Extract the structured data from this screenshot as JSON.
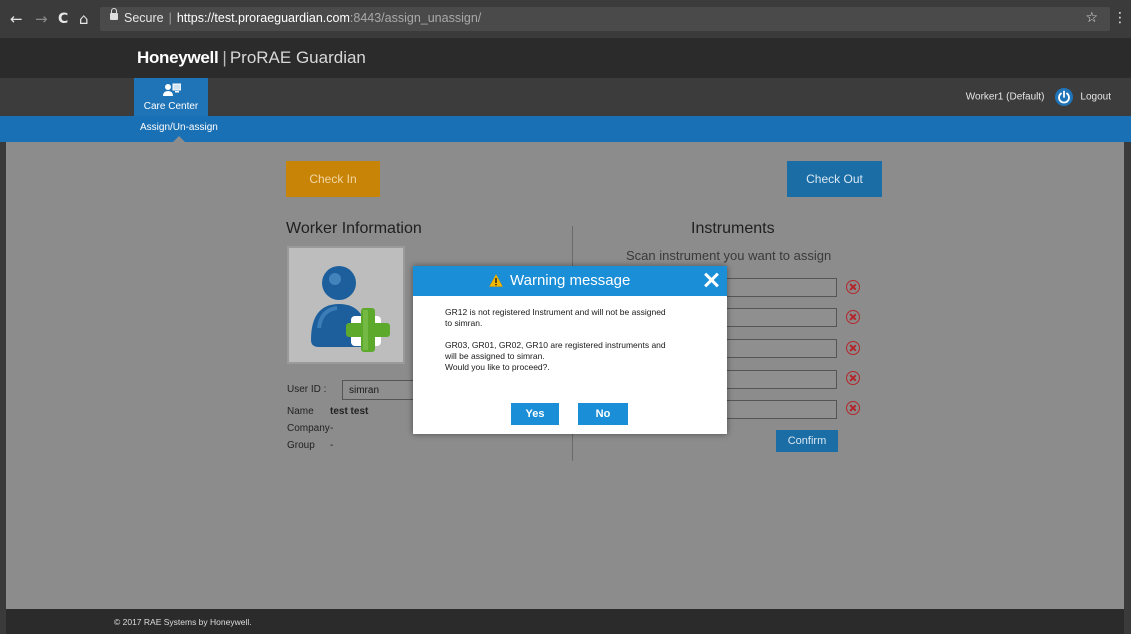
{
  "browser": {
    "back_icon": "←",
    "forward_icon": "→",
    "reload_icon": "C",
    "home_icon": "⌂",
    "secure_label": "Secure",
    "url_scheme": "https://",
    "url_host": "test.proraeguardian.com",
    "url_rest": ":8443/assign_unassign/",
    "star_icon": "☆",
    "menu_icon": "⋮"
  },
  "header": {
    "brand": "Honeywell",
    "separator": "|",
    "product": "ProRAE Guardian"
  },
  "nav": {
    "care_center_label": "Care Center",
    "user_label": "Worker1 (Default)",
    "logout_label": "Logout",
    "sub_item": "Assign/Un-assign"
  },
  "main": {
    "check_in_label": "Check In",
    "check_out_label": "Check Out",
    "worker_title": "Worker Information",
    "instruments_title": "Instruments",
    "instruments_subtitle": "Scan instrument you want to assign",
    "confirm_label": "Confirm",
    "fields": {
      "user_id_label": "User ID :",
      "user_id_value": "simran",
      "name_label": "Name",
      "name_value": "test test",
      "company_label": "Company",
      "company_value": "-",
      "group_label": "Group",
      "group_value": "-"
    },
    "scan_rows": [
      {
        "value": ""
      },
      {
        "value": ""
      },
      {
        "value": ""
      },
      {
        "value": ""
      },
      {
        "value": ""
      }
    ]
  },
  "modal": {
    "title": "Warning message",
    "warning_icon": "⚠",
    "message1_line1": "GR12 is not registered Instrument and will not be assigned",
    "message1_line2": "to simran.",
    "message2_line1": "GR03, GR01, GR02, GR10 are registered instruments and",
    "message2_line2": "will be assigned to simran.",
    "message2_line3": "Would you like to proceed?.",
    "yes_label": "Yes",
    "no_label": "No"
  },
  "footer": {
    "copyright": "© 2017 RAE Systems by Honeywell."
  },
  "colors": {
    "accent_blue": "#1f73b7",
    "modal_blue": "#1a8ed6",
    "check_in_orange": "#c88406",
    "remove_red": "#b3262b",
    "content_gray": "#8c8c8c"
  }
}
